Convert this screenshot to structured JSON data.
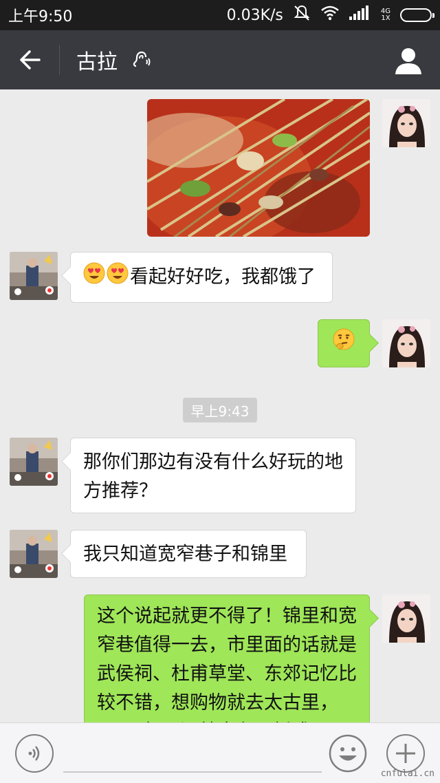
{
  "status_bar": {
    "time": "上午9:50",
    "net_speed": "0.03K/s",
    "network_top": "4G",
    "network_bottom": "1X"
  },
  "nav": {
    "title": "古拉"
  },
  "messages": [
    {
      "from": "me",
      "type": "image",
      "description_icon": "food-photo"
    },
    {
      "from": "them",
      "type": "text",
      "emojis": [
        "heart-eyes-emoji",
        "heart-eyes-emoji"
      ],
      "text": "看起好好吃，我都饿了"
    },
    {
      "from": "me",
      "type": "emoji",
      "emoji": "thinking-emoji"
    },
    {
      "from": "system",
      "type": "timestamp",
      "text": "早上9:43"
    },
    {
      "from": "them",
      "type": "text",
      "text": "那你们那边有没有什么好玩的地方推荐？"
    },
    {
      "from": "them",
      "type": "text",
      "text": "我只知道宽窄巷子和锦里"
    },
    {
      "from": "me",
      "type": "text",
      "text": "这个说起就更不得了！锦里和宽窄巷值得一去，市里面的话就是武侯祠、杜甫草堂、东郊记忆比较不错，想购物就去太古里，IFS，想喝酒就去九眼桥或"
    }
  ],
  "input_bar": {
    "placeholder": ""
  },
  "watermark": "cnfulai.cn",
  "colors": {
    "nav_bg": "#393a3f",
    "my_bubble": "#9fe658",
    "their_bubble": "#ffffff",
    "chat_bg": "#ebebeb"
  }
}
